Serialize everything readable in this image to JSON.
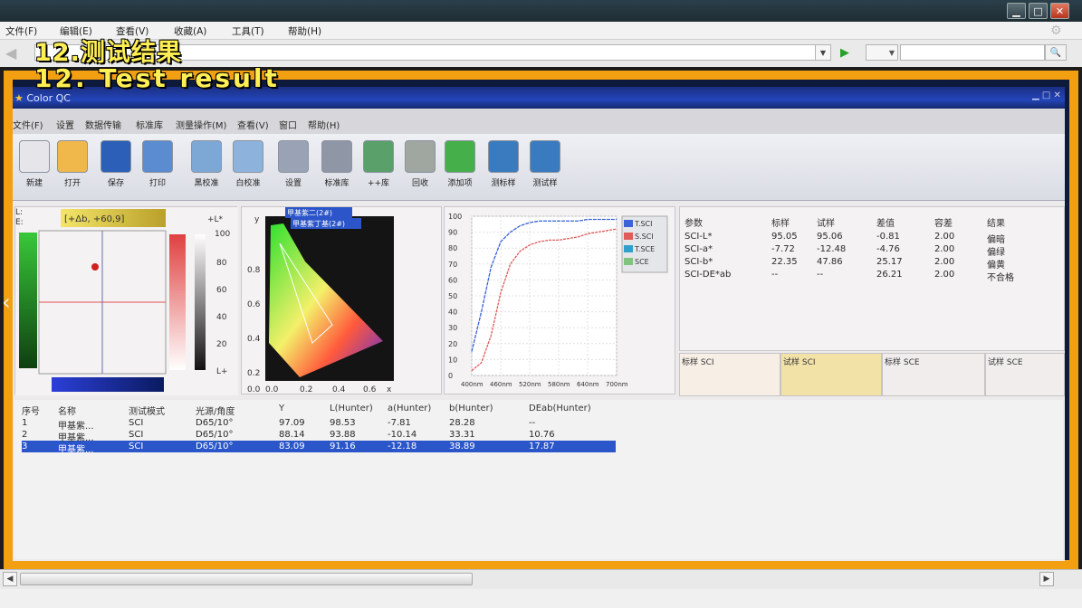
{
  "browser": {
    "menu": [
      "文件(F)",
      "编辑(E)",
      "查看(V)",
      "收藏(A)",
      "工具(T)",
      "帮助(H)"
    ],
    "window_controls": {
      "minimize": "▁",
      "maximize": "□",
      "close": "✕"
    }
  },
  "caption": {
    "cn": "12.测试结果",
    "en": "12. Test result"
  },
  "app": {
    "title": "Color QC",
    "menu": [
      "文件(F)",
      "设置",
      "数据传输",
      "标准库",
      "测量操作(M)",
      "查看(V)",
      "窗口",
      "帮助(H)"
    ],
    "toolbar": [
      {
        "label": "新建",
        "icon": "new-file-icon",
        "color": "#e6e6ea"
      },
      {
        "label": "打开",
        "icon": "open-folder-icon",
        "color": "#f0b84a"
      },
      {
        "label": "保存",
        "icon": "save-disk-icon",
        "color": "#2b5fb8"
      },
      {
        "label": "打印",
        "icon": "printer-icon",
        "color": "#5b8bd0"
      },
      {
        "label": "黑校准",
        "icon": "black-calibrate-icon",
        "color": "#7da8d6"
      },
      {
        "label": "白校准",
        "icon": "white-calibrate-icon",
        "color": "#8db3dc"
      },
      {
        "label": "设置",
        "icon": "settings-gear-icon",
        "color": "#9aa3b5"
      },
      {
        "label": "标准库",
        "icon": "database-icon",
        "color": "#8f96a6"
      },
      {
        "label": "++库",
        "icon": "database-add-icon",
        "color": "#5aa06a"
      },
      {
        "label": "回收",
        "icon": "recycle-icon",
        "color": "#9fa7a0"
      },
      {
        "label": "添加项",
        "icon": "check-add-icon",
        "color": "#45b04a"
      },
      {
        "label": "测标样",
        "icon": "measure-standard-icon",
        "color": "#3a7bc0"
      },
      {
        "label": "测试样",
        "icon": "measure-sample-icon",
        "color": "#3a7bc0"
      }
    ],
    "lab_panel": {
      "header": "[+Δb, +60,9]",
      "left_label": "L:",
      "left_label2": "E:",
      "l_scale": [
        "100",
        "80",
        "60",
        "40",
        "20",
        "L+"
      ],
      "top_marker": "+L*"
    },
    "chroma_panel": {
      "legend1": "甲基紫二(2#)",
      "legend2": "甲基紫丁基(2#)",
      "y_ticks": [
        "0.8",
        "0.6",
        "0.4",
        "0.2",
        "0.0"
      ],
      "x_ticks": [
        "0.0",
        "0.2",
        "0.4",
        "0.6",
        "x"
      ],
      "y_axis": "y"
    },
    "spectrum_panel": {
      "y_ticks": [
        "100",
        "90",
        "80",
        "70",
        "60",
        "50",
        "40",
        "30",
        "20",
        "10",
        "0"
      ],
      "x_ticks": [
        "400nm",
        "460nm",
        "520nm",
        "580nm",
        "640nm",
        "700nm"
      ],
      "legend": [
        {
          "name": "T.SCI",
          "color": "#3a63d8"
        },
        {
          "name": "S.SCI",
          "color": "#e05a5a"
        },
        {
          "name": "T.SCE",
          "color": "#2fa0c9"
        },
        {
          "name": "SCE",
          "color": "#7fc47f"
        }
      ]
    },
    "diff_table": {
      "headers": [
        "参数",
        "标样",
        "试样",
        "差值",
        "容差",
        "结果"
      ],
      "rows": [
        [
          "SCI-L*",
          "95.05",
          "95.06",
          "-0.81",
          "2.00",
          "偏暗"
        ],
        [
          "SCI-a*",
          "-7.72",
          "-12.48",
          "-4.76",
          "2.00",
          "偏绿"
        ],
        [
          "SCI-b*",
          "22.35",
          "47.86",
          "25.17",
          "2.00",
          "偏黄"
        ],
        [
          "SCI-DE*ab",
          "--",
          "--",
          "26.21",
          "2.00",
          "不合格"
        ]
      ]
    },
    "swatches": [
      {
        "label": "标样 SCI",
        "color": "#f7efe6"
      },
      {
        "label": "试样 SCI",
        "color": "#f3e2a8"
      },
      {
        "label": "标样 SCE",
        "color": "#f1eded"
      },
      {
        "label": "试样 SCE",
        "color": "#f1eded"
      }
    ],
    "results": {
      "headers": [
        "序号",
        "名称",
        "测试模式",
        "光源/角度",
        "Y",
        "L(Hunter)",
        "a(Hunter)",
        "b(Hunter)",
        "DEab(Hunter)"
      ],
      "rows": [
        [
          "1",
          "甲基紫...",
          "SCI",
          "D65/10°",
          "97.09",
          "98.53",
          "-7.81",
          "28.28",
          "--"
        ],
        [
          "2",
          "甲基紫...",
          "SCI",
          "D65/10°",
          "88.14",
          "93.88",
          "-10.14",
          "33.31",
          "10.76"
        ],
        [
          "3",
          "甲基紫...",
          "SCI",
          "D65/10°",
          "83.09",
          "91.16",
          "-12.18",
          "38.89",
          "17.87"
        ]
      ],
      "selected_row": 2
    }
  },
  "chart_data": {
    "type": "line",
    "x": [
      400,
      420,
      440,
      460,
      480,
      500,
      520,
      540,
      560,
      580,
      600,
      620,
      640,
      660,
      680,
      700
    ],
    "xlim": [
      400,
      700
    ],
    "ylim": [
      0,
      100
    ],
    "series": [
      {
        "name": "T.SCI",
        "values": [
          15,
          40,
          68,
          84,
          90,
          94,
          96,
          97,
          97,
          97,
          97,
          97,
          98,
          98,
          98,
          98
        ]
      },
      {
        "name": "S.SCI",
        "values": [
          3,
          8,
          25,
          52,
          70,
          78,
          82,
          84,
          85,
          85,
          86,
          87,
          89,
          90,
          91,
          92
        ]
      }
    ]
  }
}
